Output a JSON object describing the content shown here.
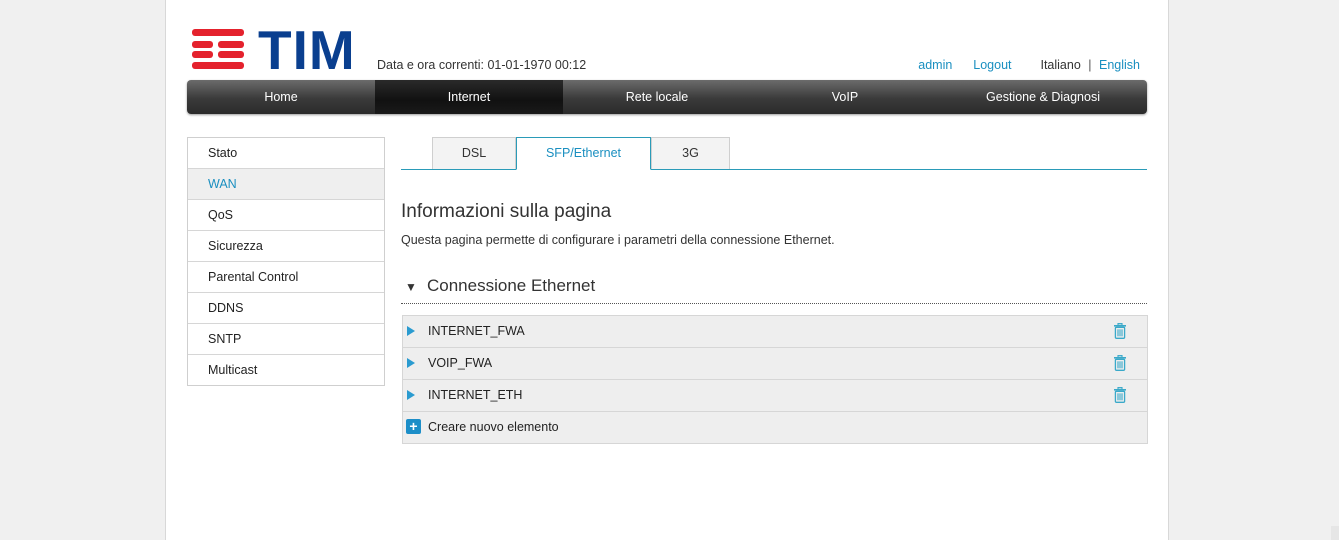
{
  "brand": {
    "name": "TIM",
    "bar_color": "#e4222d",
    "text_color": "#0a3f8f"
  },
  "header": {
    "datetime": "Data e ora correnti: 01-01-1970 00:12",
    "user_link": "admin",
    "logout_link": "Logout",
    "language_current": "Italiano",
    "language_separator": "|",
    "language_other": "English"
  },
  "nav": {
    "items": [
      {
        "label": "Home"
      },
      {
        "label": "Internet"
      },
      {
        "label": "Rete locale"
      },
      {
        "label": "VoIP"
      },
      {
        "label": "Gestione & Diagnosi"
      }
    ],
    "active": "Internet"
  },
  "sidebar": {
    "items": [
      {
        "label": "Stato"
      },
      {
        "label": "WAN"
      },
      {
        "label": "QoS"
      },
      {
        "label": "Sicurezza"
      },
      {
        "label": "Parental Control"
      },
      {
        "label": "DDNS"
      },
      {
        "label": "SNTP"
      },
      {
        "label": "Multicast"
      }
    ],
    "active": "WAN"
  },
  "tabs": {
    "items": [
      {
        "label": "DSL"
      },
      {
        "label": "SFP/Ethernet"
      },
      {
        "label": "3G"
      }
    ],
    "active": "SFP/Ethernet"
  },
  "info": {
    "title": "Informazioni sulla pagina",
    "description": "Questa pagina permette di configurare i parametri della connessione Ethernet."
  },
  "section": {
    "title": "Connessione Ethernet",
    "connections": [
      {
        "name": "INTERNET_FWA",
        "icon": "trash-icon"
      },
      {
        "name": "VOIP_FWA",
        "icon": "trash-icon"
      },
      {
        "name": "INTERNET_ETH",
        "icon": "trash-icon"
      }
    ],
    "create_label": "Creare nuovo elemento"
  },
  "colors": {
    "accent": "#1a8fc0",
    "tab_border": "#2a9bb8"
  }
}
